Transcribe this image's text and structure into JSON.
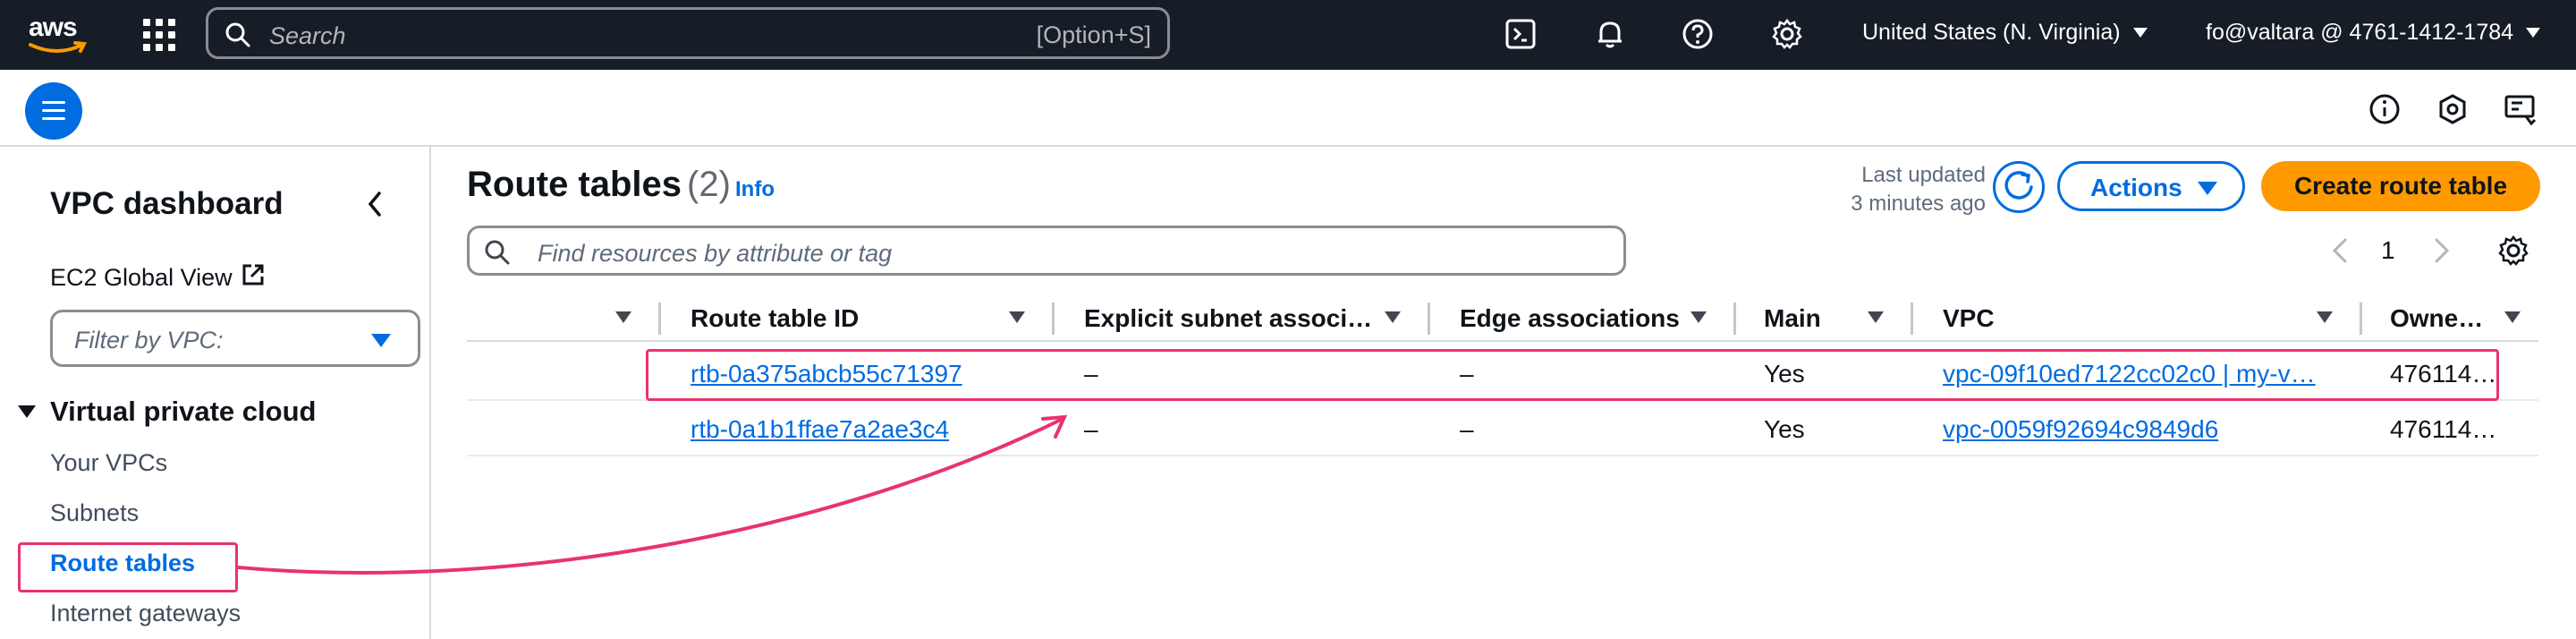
{
  "topnav": {
    "logo_text": "aws",
    "search_placeholder": "Search",
    "search_shortcut": "[Option+S]",
    "region": "United States (N. Virginia)",
    "account": "fo@valtara @ 4761-1412-1784"
  },
  "sidebar": {
    "title": "VPC dashboard",
    "ec2_global_view": "EC2 Global View",
    "filter_placeholder": "Filter by VPC:",
    "section_title": "Virtual private cloud",
    "items": [
      {
        "label": "Your VPCs",
        "active": false
      },
      {
        "label": "Subnets",
        "active": false
      },
      {
        "label": "Route tables",
        "active": true
      },
      {
        "label": "Internet gateways",
        "active": false
      }
    ]
  },
  "main": {
    "title": "Route tables",
    "count": "(2)",
    "info_label": "Info",
    "last_updated_line1": "Last updated",
    "last_updated_line2": "3 minutes ago",
    "actions_label": "Actions",
    "create_label": "Create route table",
    "filter_placeholder": "Find resources by attribute or tag",
    "page_number": "1"
  },
  "table": {
    "columns": [
      "Route table ID",
      "Explicit subnet associ…",
      "Edge associations",
      "Main",
      "VPC",
      "Owne…"
    ],
    "rows": [
      {
        "id": "rtb-0a375abcb55c71397",
        "explicit": "–",
        "edge": "–",
        "main": "Yes",
        "vpc": "vpc-09f10ed7122cc02c0 | my-v…",
        "owner": "476114…"
      },
      {
        "id": "rtb-0a1b1ffae7a2ae3c4",
        "explicit": "–",
        "edge": "–",
        "main": "Yes",
        "vpc": "vpc-0059f92694c9849d6",
        "owner": "476114…"
      }
    ]
  },
  "colors": {
    "nav_bg": "#161d26",
    "link_blue": "#006ce0",
    "primary_orange": "#ff9900",
    "annotation_pink": "#e8336d"
  }
}
